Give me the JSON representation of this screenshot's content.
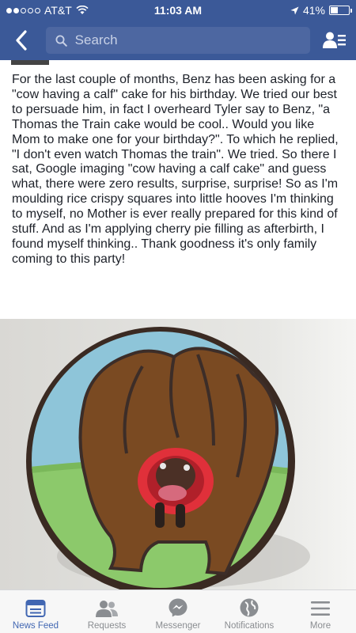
{
  "status_bar": {
    "carrier": "AT&T",
    "time": "11:03 AM",
    "battery": "41%",
    "battery_level": 0.41
  },
  "nav": {
    "search_placeholder": "Search"
  },
  "post": {
    "text": "For the last couple of months, Benz has been asking for a \"cow having a calf\" cake for his birthday.  We tried our best to persuade him, in fact I overheard Tyler say to Benz, \"a Thomas the Train cake would be cool.. Would you like Mom to make one for your birthday?\". To which he replied, \"I don't even watch Thomas the train\". We tried. So there I sat, Google imaging \"cow having a calf cake\" and guess what, there were zero results, surprise, surprise! So as I'm moulding rice crispy squares into little hooves I'm thinking to myself, no Mother is ever really prepared for this kind of stuff. And as I'm applying cherry pie filling as afterbirth, I found myself thinking.. Thank goodness it's only family coming to this party!"
  },
  "tabs": [
    {
      "label": "News Feed",
      "icon": "news-feed-icon",
      "active": true
    },
    {
      "label": "Requests",
      "icon": "friend-requests-icon",
      "active": false
    },
    {
      "label": "Messenger",
      "icon": "messenger-icon",
      "active": false
    },
    {
      "label": "Notifications",
      "icon": "globe-icon",
      "active": false
    },
    {
      "label": "More",
      "icon": "hamburger-icon",
      "active": false
    }
  ],
  "colors": {
    "brand": "#3b5998",
    "active_tab": "#4267b2",
    "inactive_tab": "#8a8d91"
  }
}
